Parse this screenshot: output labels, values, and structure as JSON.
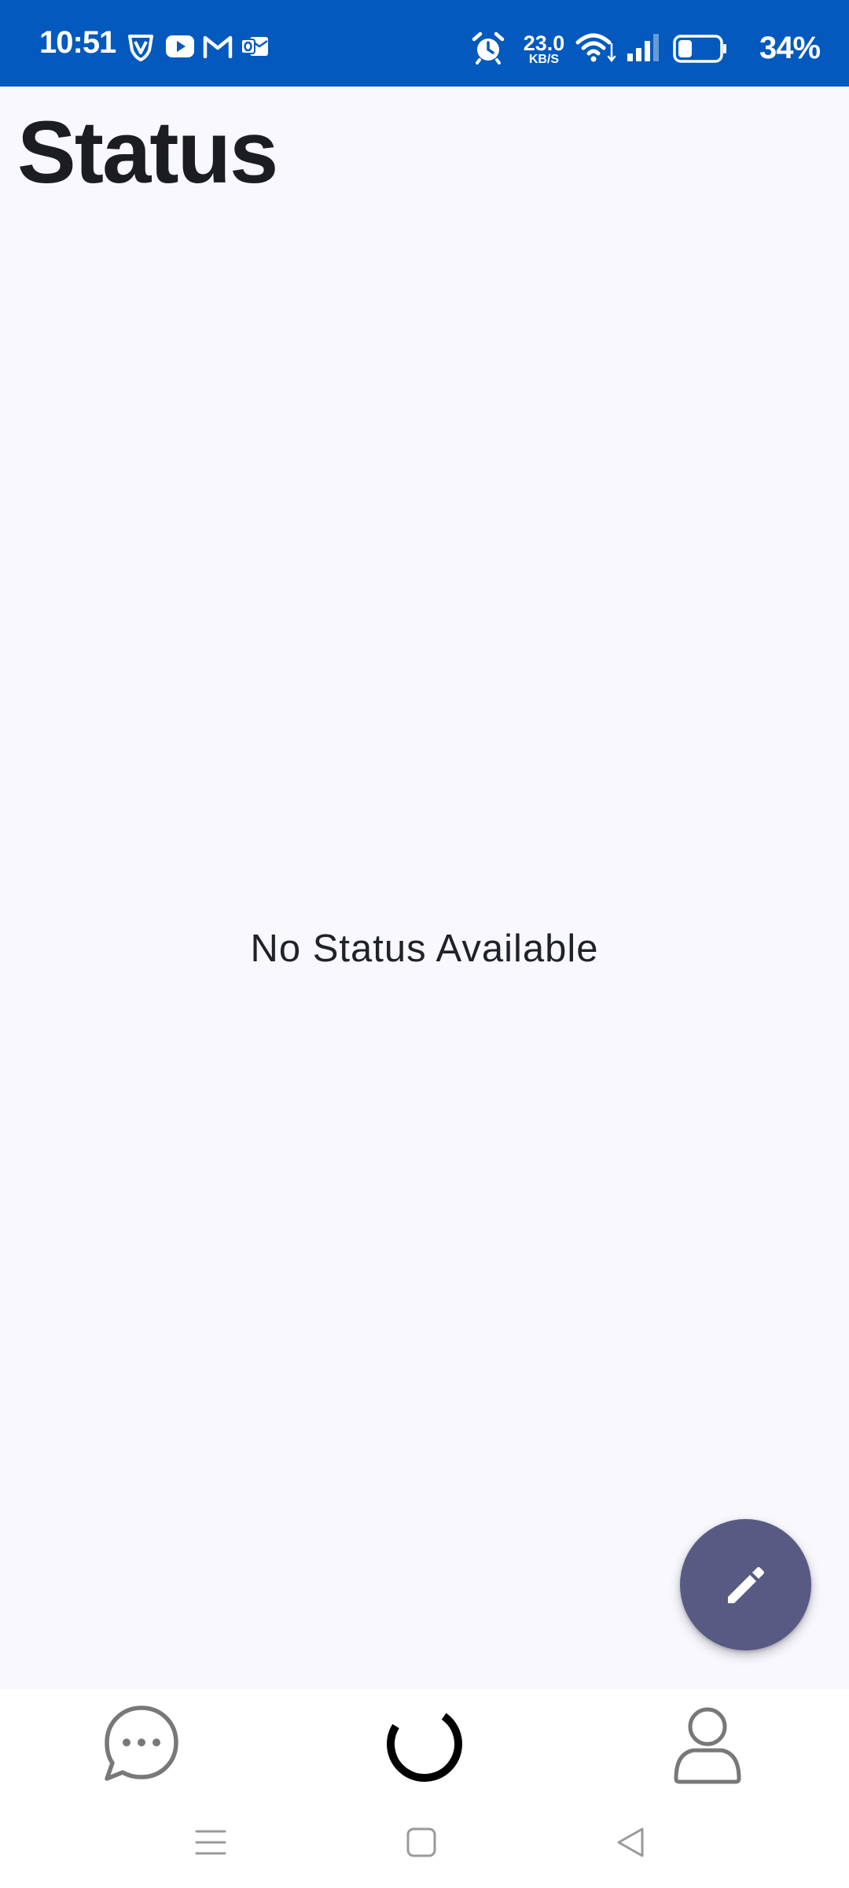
{
  "status_bar": {
    "time": "10:51",
    "network_speed_value": "23.0",
    "network_speed_unit": "KB/S",
    "battery_percent": "34%",
    "background_color": "#0359bd",
    "left_icons": [
      "vpn-shield-icon",
      "youtube-icon",
      "gmail-icon",
      "outlook-icon"
    ],
    "right_icons": [
      "alarm-icon",
      "wifi-icon",
      "cellular-signal-icon",
      "battery-icon"
    ],
    "battery_level": 0.34
  },
  "page": {
    "title": "Status",
    "empty_message": "No Status Available",
    "background_color": "#f8f8fe"
  },
  "fab": {
    "icon": "pencil-icon",
    "color": "#585a84"
  },
  "bottom_nav": {
    "items": [
      {
        "id": "chats",
        "icon": "chat-bubble-icon",
        "selected": false
      },
      {
        "id": "status",
        "icon": "status-ring-icon",
        "selected": true
      },
      {
        "id": "profile",
        "icon": "person-icon",
        "selected": false
      }
    ]
  },
  "system_nav": {
    "buttons": [
      "menu-icon",
      "home-icon",
      "back-icon"
    ]
  }
}
